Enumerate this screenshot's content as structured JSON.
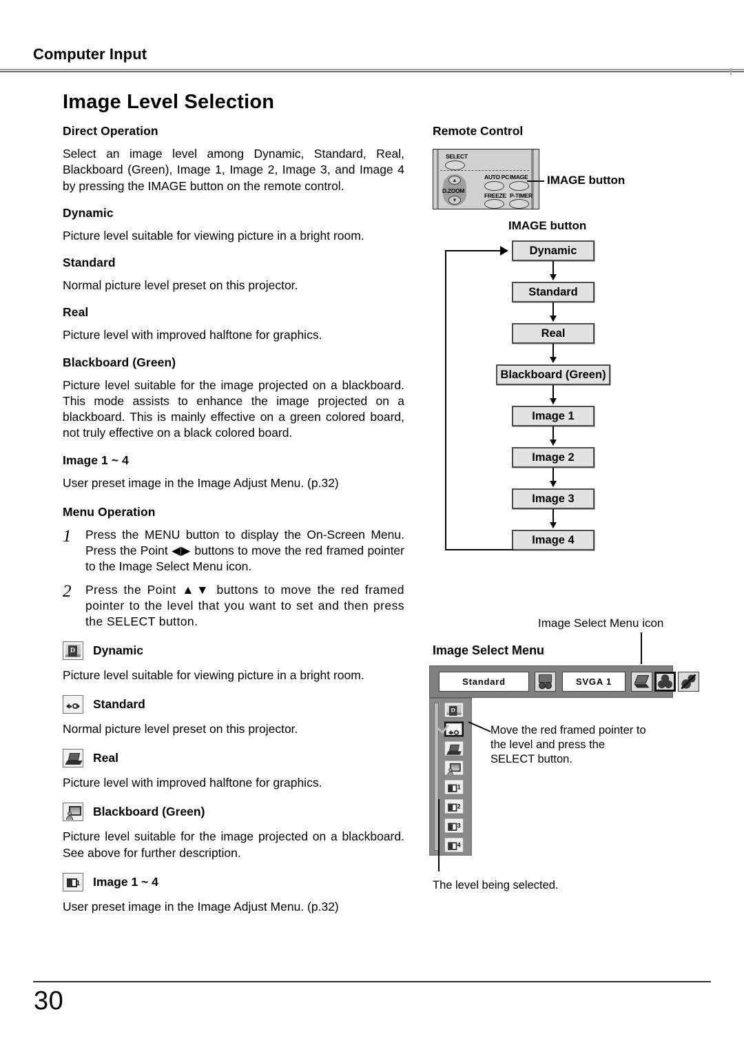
{
  "header": {
    "running_head": "Computer Input",
    "page_title": "Image Level Selection"
  },
  "left_column": {
    "direct_operation_heading": "Direct Operation",
    "direct_operation_body": "Select an image level among Dynamic, Standard, Real, Blackboard (Green), Image 1, Image 2, Image 3, and Image 4 by pressing the IMAGE button on the remote control.",
    "levels": [
      {
        "heading": "Dynamic",
        "body": "Picture level suitable for viewing picture in a bright room."
      },
      {
        "heading": "Standard",
        "body": "Normal picture level preset on this projector."
      },
      {
        "heading": "Real",
        "body": "Picture level with improved halftone for graphics."
      },
      {
        "heading": "Blackboard (Green)",
        "body": "Picture level suitable for the image projected on a blackboard.  This mode assists to enhance the image projected on a blackboard.  This is mainly effective on a green colored board, not truly effective on a black colored board."
      },
      {
        "heading": "Image 1 ~ 4",
        "body": "User preset image in the Image Adjust Menu. (p.32)"
      }
    ],
    "menu_operation_heading": "Menu Operation",
    "steps": [
      {
        "num": "1",
        "text": "Press the MENU button to display the On-Screen Menu.  Press the Point ◀▶ buttons to move the red framed pointer to the Image Select Menu icon."
      },
      {
        "num": "2",
        "text": "Press the Point ▲▼ buttons to move the red framed pointer to the level that you want to set and then press the SELECT button."
      }
    ],
    "menu_levels": [
      {
        "icon": "dynamic-level-icon",
        "heading": "Dynamic",
        "body": "Picture level suitable for viewing picture in a bright room."
      },
      {
        "icon": "standard-level-icon",
        "heading": "Standard",
        "body": "Normal picture level preset on this projector."
      },
      {
        "icon": "real-level-icon",
        "heading": "Real",
        "body": "Picture level with improved halftone for graphics."
      },
      {
        "icon": "blackboard-level-icon",
        "heading": "Blackboard (Green)",
        "body": "Picture level suitable for the image projected on a blackboard.  See above for further description."
      },
      {
        "icon": "image-1-level-icon",
        "heading": "Image 1 ~ 4",
        "body": "User preset image in the Image Adjust Menu. (p.32)"
      }
    ]
  },
  "right_column": {
    "remote_control_heading": "Remote Control",
    "remote": {
      "select_label": "SELECT",
      "dzoom_label": "D.ZOOM",
      "autopc_label": "AUTO PC",
      "image_label": "IMAGE",
      "freeze_label": "FREEZE",
      "ptimer_label": "P-TIMER",
      "callout": "IMAGE button",
      "dzoom_up": "▲",
      "dzoom_down": "▼"
    },
    "flow": {
      "caption": "IMAGE button",
      "boxes": [
        "Dynamic",
        "Standard",
        "Real",
        "Blackboard (Green)",
        "Image 1",
        "Image 2",
        "Image 3",
        "Image 4"
      ]
    },
    "osd": {
      "section_title": "Image Select Menu",
      "icon_callout": "Image Select Menu icon",
      "level_field": "Standard",
      "source_field": "SVGA 1",
      "note_pointer": "Move the red framed pointer to the level and press the SELECT button.",
      "note_selected": "The level being selected.",
      "list_items": [
        "dynamic-level-icon",
        "standard-level-icon",
        "real-level-icon",
        "blackboard-level-icon",
        "image-1-level-icon",
        "image-2-level-icon",
        "image-3-level-icon",
        "image-4-level-icon"
      ]
    }
  },
  "footer": {
    "page_number": "30"
  }
}
